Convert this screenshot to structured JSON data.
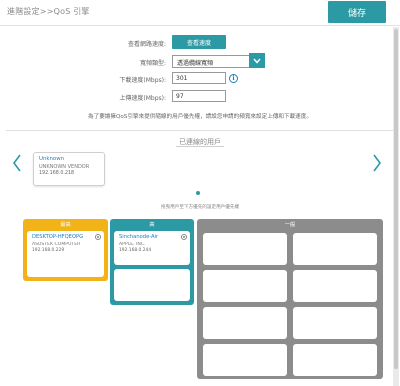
{
  "header": {
    "title": "進階設定>>QoS 引擎",
    "save_label": "儲存"
  },
  "form": {
    "view_network_label": "查看網路速度:",
    "view_network_button": "查看速度",
    "connection_type_label": "寬頻類型:",
    "connection_type_value": "透過纜線寬頻",
    "upload_label": "下載速度(Mbps):",
    "upload_value": "301",
    "download_label": "上傳速度(Mbps):",
    "download_value": "97",
    "info_icon": "i"
  },
  "note": "為了要讓擁QoS引擎來提供隨線的用戶優先權，請設您申請的頻寬來設定上傳和下載速度。",
  "connected": {
    "title": "已連線的用戶",
    "hint": "拖曳用戶至下方優先的設定用戶優先權",
    "clients": [
      {
        "name": "Unknown",
        "vendor": "UNKNOWN VENDOR",
        "ip": "192.168.0.218"
      }
    ]
  },
  "priority": {
    "highest_label": "最高",
    "high_label": "高",
    "normal_label": "一般",
    "highest_clients": [
      {
        "name": "DESKTOP-HFQEOPG",
        "vendor": "ASUSTEK COMPUTER",
        "ip": "192.168.0.229"
      }
    ],
    "high_clients": [
      {
        "name": "Sinchanode-Air",
        "vendor": "APPLE, INC.",
        "ip": "192.168.0.244"
      }
    ]
  },
  "colors": {
    "accent": "#2c9aa4",
    "highest": "#f2b318",
    "high": "#2c9aa4",
    "normal": "#8c8c8c",
    "link": "#1a7fc1"
  }
}
